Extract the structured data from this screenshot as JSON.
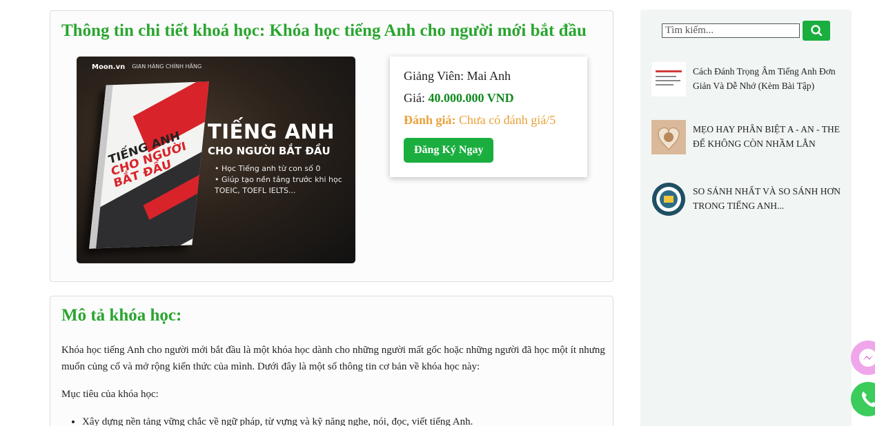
{
  "detail": {
    "title": "Thông tin chi tiết khoá học: Khóa học tiếng Anh cho người mới bắt đầu",
    "image": {
      "brand": "Moon.vn",
      "badge": "GIAN HÀNG CHÍNH HÃNG",
      "book_title_1": "TIẾNG ANH",
      "book_title_2": "CHO NGƯỜI BẮT ĐẦU",
      "headline_1": "TIẾNG ANH",
      "headline_2": "CHO NGƯỜI BẮT ĐẦU",
      "bullets": [
        "Học Tiếng anh từ con số 0",
        "Giúp tạo nền tảng trước khi học TOEIC, TOEFL IELTS..."
      ]
    },
    "instructor_label": "Giảng Viên: Mai Anh",
    "price_label": "Giá:",
    "price_value": "40.000.000 VND",
    "rating_label": "Đánh giá:",
    "rating_value": "Chưa có đánh giá/5",
    "register_button": "Đăng Ký Ngay"
  },
  "description": {
    "title": "Mô tả khóa học:",
    "paragraph": "Khóa học tiếng Anh cho người mới bắt đầu là một khóa học dành cho những người mất gốc hoặc những người đã học một ít nhưng muốn củng cố và mở rộng kiến thức của mình. Dưới đây là một số thông tin cơ bản về khóa học này:",
    "goal_label": "Mục tiêu của khóa học:",
    "goals": [
      "Xây dựng nền tảng vững chắc về ngữ pháp, từ vựng và kỹ năng nghe, nói, đọc, viết tiếng Anh."
    ]
  },
  "sidebar": {
    "search_placeholder": "Tìm kiếm...",
    "posts": [
      {
        "title": "Cách Đánh Trọng Âm Tiếng Anh Đơn Giản Và Dễ Nhớ (Kèm Bài Tập)"
      },
      {
        "title": "MẸO HAY PHÂN BIỆT A - AN - THE ĐỂ KHÔNG CÒN NHẦM LẪN"
      },
      {
        "title": "SO SÁNH NHẤT VÀ SO SÁNH HƠN TRONG TIẾNG ANH..."
      }
    ]
  },
  "colors": {
    "accent": "#1aae3f",
    "title": "#2aa52f",
    "price": "#128a1f",
    "rating": "#e8a23a"
  }
}
